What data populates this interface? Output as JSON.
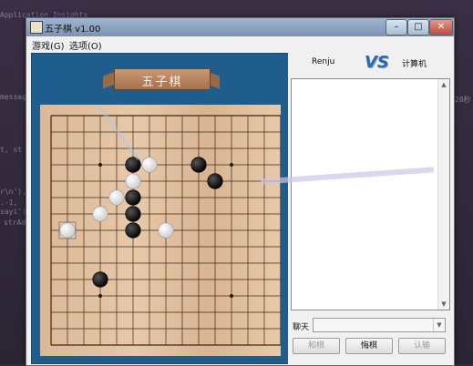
{
  "background": {
    "lines": [
      "message",
      "t, st",
      "r\\n'),",
      ".-1,",
      "sayi')",
      "strAd",
      "20秒",
      "Application Insights"
    ]
  },
  "window": {
    "title": "五子棋 v1.00",
    "controls": {
      "minimize": "–",
      "maximize": "□",
      "close": "✕"
    }
  },
  "menu": {
    "game": "游戏(G)",
    "options": "选项(O)"
  },
  "banner": {
    "text": "五子棋"
  },
  "board": {
    "size": 15,
    "black_stones": [
      [
        5,
        3
      ],
      [
        9,
        3
      ],
      [
        5,
        5
      ],
      [
        5,
        6
      ],
      [
        5,
        7
      ],
      [
        10,
        4
      ],
      [
        3,
        10
      ]
    ],
    "white_stones": [
      [
        6,
        3
      ],
      [
        5,
        4
      ],
      [
        4,
        5
      ],
      [
        3,
        6
      ],
      [
        7,
        7
      ],
      [
        1,
        7
      ]
    ],
    "last_move": [
      1,
      7
    ],
    "star_points": [
      [
        3,
        3
      ],
      [
        11,
        3
      ],
      [
        3,
        11
      ],
      [
        11,
        11
      ]
    ]
  },
  "players": {
    "left_name": "Renju",
    "vs": "VS",
    "right_name": "计算机"
  },
  "chat": {
    "label": "聊天",
    "input_value": ""
  },
  "buttons": {
    "draw": "和棋",
    "undo": "悔棋",
    "resign": "认输"
  },
  "colors": {
    "panel_blue": "#1f5d8c",
    "vs_blue": "#2a6aa8"
  }
}
